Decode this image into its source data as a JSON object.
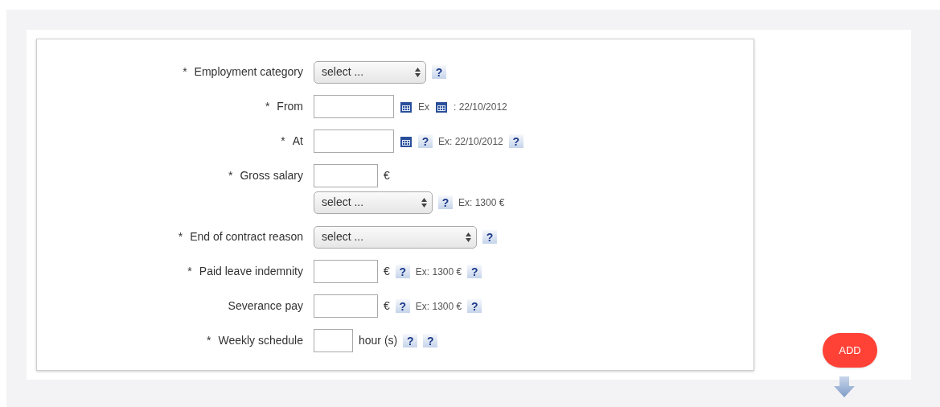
{
  "form": {
    "rows": [
      {
        "marker": "*",
        "label": "Employment category",
        "lines": [
          [
            {
              "kind": "select",
              "value": "select ..."
            },
            {
              "kind": "help",
              "text": "?"
            }
          ]
        ]
      },
      {
        "marker": "*",
        "label": "From",
        "lines": [
          [
            {
              "kind": "input"
            },
            {
              "kind": "calendar"
            },
            {
              "kind": "text",
              "text": "Ex"
            },
            {
              "kind": "calendar"
            },
            {
              "kind": "text",
              "text": ": 22/10/2012"
            }
          ]
        ]
      },
      {
        "marker": "*",
        "label": "At",
        "lines": [
          [
            {
              "kind": "input"
            },
            {
              "kind": "calendar"
            },
            {
              "kind": "help",
              "text": "?"
            },
            {
              "kind": "text",
              "text": "Ex: 22/10/2012"
            },
            {
              "kind": "help",
              "text": "?"
            }
          ]
        ]
      },
      {
        "marker": "*",
        "label": "Gross salary",
        "lines": [
          [
            {
              "kind": "input"
            },
            {
              "kind": "unit",
              "text": "€"
            }
          ],
          [
            {
              "kind": "select",
              "value": "select ..."
            },
            {
              "kind": "help",
              "text": "?"
            },
            {
              "kind": "text",
              "text": "Ex: 1300 €"
            }
          ]
        ]
      },
      {
        "marker": "*",
        "label": "End of contract reason",
        "lines": [
          [
            {
              "kind": "select",
              "value": "select ..."
            },
            {
              "kind": "help",
              "text": "?"
            }
          ]
        ]
      },
      {
        "marker": "*",
        "label": "Paid leave indemnity",
        "lines": [
          [
            {
              "kind": "input"
            },
            {
              "kind": "unit",
              "text": "€"
            },
            {
              "kind": "help",
              "text": "?"
            },
            {
              "kind": "text",
              "text": "Ex: 1300 €"
            },
            {
              "kind": "help",
              "text": "?"
            }
          ]
        ]
      },
      {
        "label": "Severance pay",
        "lines": [
          [
            {
              "kind": "input"
            },
            {
              "kind": "unit",
              "text": "€"
            },
            {
              "kind": "help",
              "text": "?"
            },
            {
              "kind": "text",
              "text": "Ex: 1300 €"
            },
            {
              "kind": "help",
              "text": "?"
            }
          ]
        ]
      },
      {
        "marker": "*",
        "label": "Weekly schedule",
        "lines": [
          [
            {
              "kind": "input"
            },
            {
              "kind": "unit",
              "text": "hour (s)"
            },
            {
              "kind": "help",
              "text": "?"
            },
            {
              "kind": "help",
              "text": "?"
            }
          ]
        ]
      }
    ]
  },
  "add_button": {
    "label": "ADD"
  }
}
